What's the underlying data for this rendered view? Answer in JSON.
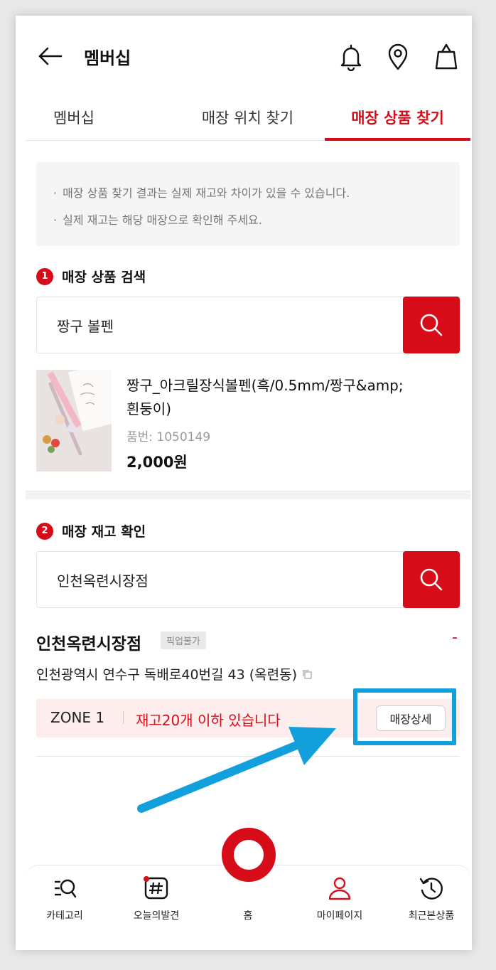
{
  "header": {
    "title": "멤버십",
    "back_icon": "back-arrow-icon",
    "icons": [
      "bell-icon",
      "location-pin-icon",
      "shopping-bag-icon"
    ]
  },
  "tabs": [
    {
      "label": "멤버십",
      "active": false
    },
    {
      "label": "매장 위치 찾기",
      "active": false
    },
    {
      "label": "매장 상품 찾기",
      "active": true
    }
  ],
  "notice": {
    "lines": [
      "매장 상품 찾기 결과는 실제 재고와 차이가 있을 수 있습니다.",
      "실제 재고는 해당 매장으로 확인해 주세요."
    ]
  },
  "product_search": {
    "step": "1",
    "title": "매장 상품 검색",
    "input_value": "짱구 볼펜"
  },
  "product": {
    "name": "짱구_아크릴장식볼펜(흑/0.5mm/짱구&amp;흰둥이)",
    "code": "품번: 1050149",
    "price": "2,000원"
  },
  "stock_check": {
    "step": "2",
    "title": "매장 재고 확인",
    "input_value": "인천옥련시장점"
  },
  "store": {
    "name": "인천옥련시장점",
    "pickup_badge": "픽업불가",
    "toggle": "-",
    "address": "인천광역시 연수구 독배로40번길 43 (옥련동)",
    "zone": "ZONE 1",
    "stock_text": "재고20개 이하 있습니다",
    "detail_button": "매장상세"
  },
  "bottom_nav": [
    {
      "label": "카테고리",
      "icon": "category-search-icon"
    },
    {
      "label": "오늘의발견",
      "icon": "hashtag-icon"
    },
    {
      "label": "홈",
      "icon": "home-ring-icon"
    },
    {
      "label": "마이페이지",
      "icon": "person-icon"
    },
    {
      "label": "최근본상품",
      "icon": "history-icon"
    }
  ],
  "colors": {
    "accent": "#d70c19",
    "highlight": "#12a0dc",
    "zone_bg": "#fdeeed"
  }
}
